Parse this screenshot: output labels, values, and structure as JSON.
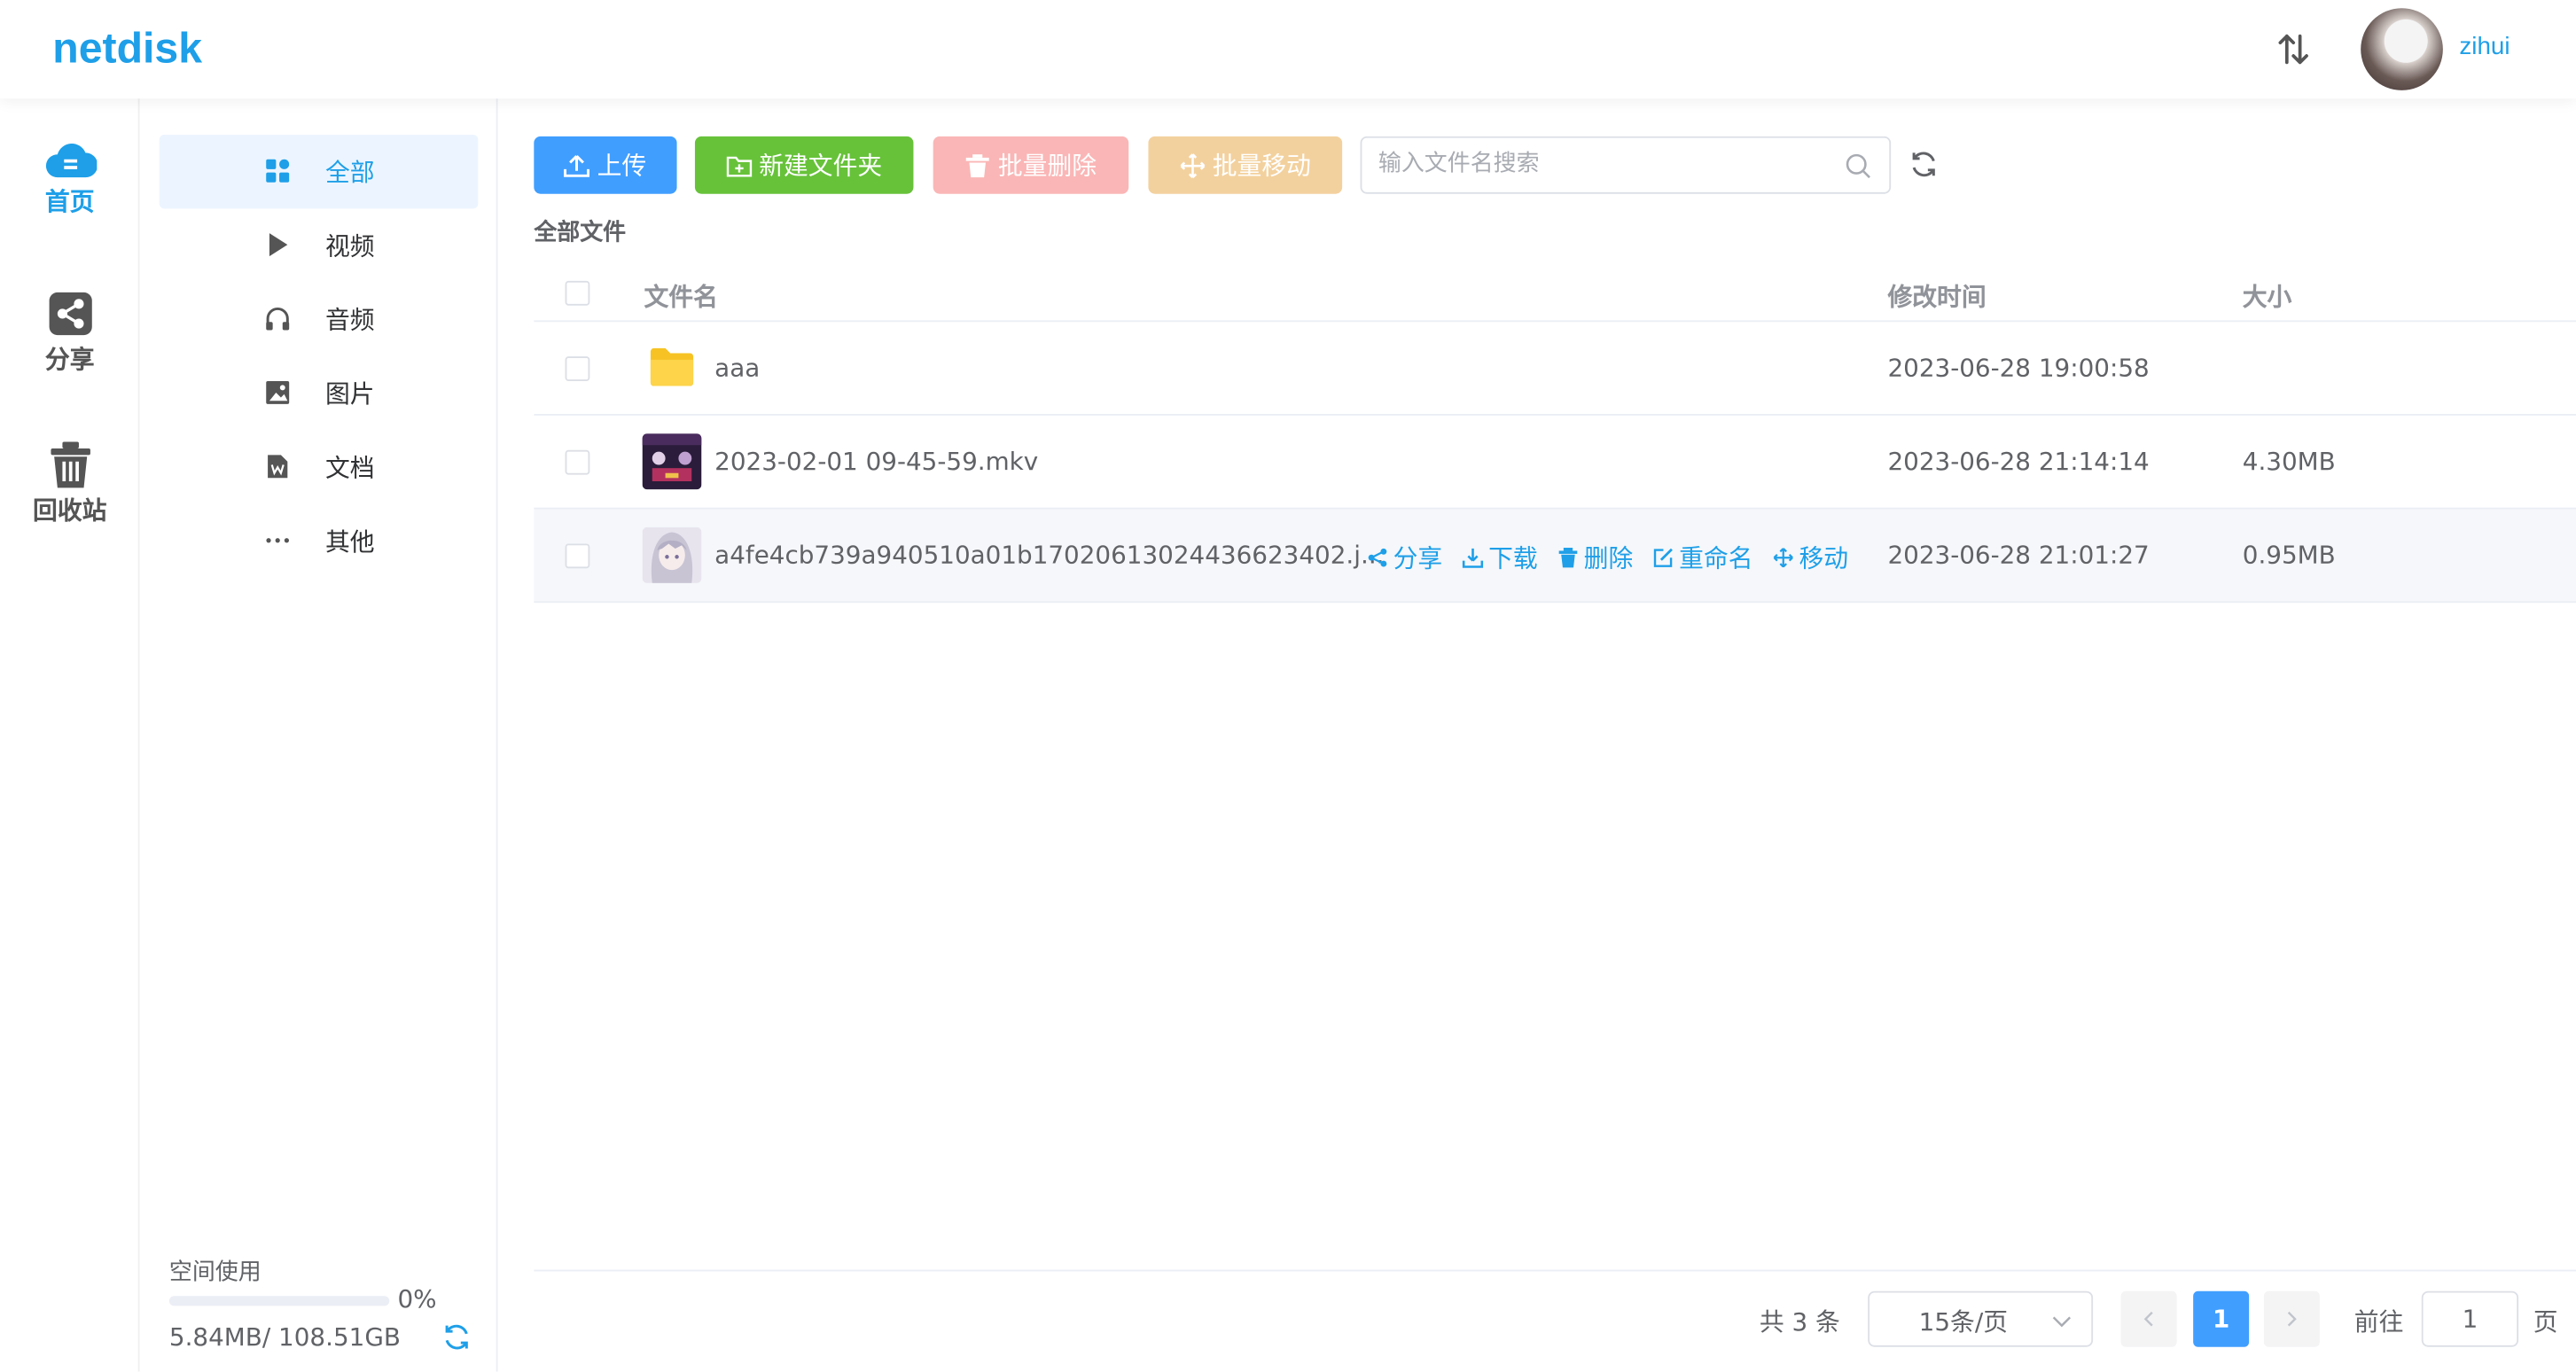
{
  "header": {
    "logo": "netdisk",
    "username": "zihui"
  },
  "leftnav": [
    {
      "label": "首页",
      "icon": "cloud-icon",
      "active": true
    },
    {
      "label": "分享",
      "icon": "share-icon",
      "active": false
    },
    {
      "label": "回收站",
      "icon": "trash-icon",
      "active": false
    }
  ],
  "categories": [
    {
      "label": "全部",
      "icon": "grid-icon",
      "active": true
    },
    {
      "label": "视频",
      "icon": "play-icon"
    },
    {
      "label": "音频",
      "icon": "headphones-icon"
    },
    {
      "label": "图片",
      "icon": "image-icon"
    },
    {
      "label": "文档",
      "icon": "document-icon"
    },
    {
      "label": "其他",
      "icon": "more-icon"
    }
  ],
  "space": {
    "label": "空间使用",
    "percent": "0%",
    "usage": "5.84MB/ 108.51GB",
    "fraction": 0.0
  },
  "toolbar": {
    "upload": "上传",
    "new_folder": "新建文件夹",
    "batch_delete": "批量删除",
    "batch_move": "批量移动",
    "search_placeholder": "输入文件名搜索"
  },
  "breadcrumb": "全部文件",
  "table": {
    "columns": {
      "name": "文件名",
      "time": "修改时间",
      "size": "大小"
    },
    "rows": [
      {
        "name": "aaa",
        "time": "2023-06-28 19:00:58",
        "size": "",
        "type": "folder"
      },
      {
        "name": "2023-02-01 09-45-59.mkv",
        "time": "2023-06-28 21:14:14",
        "size": "4.30MB",
        "type": "video"
      },
      {
        "name": "a4fe4cb739a940510a01b17020613024436623402.j...",
        "time": "2023-06-28 21:01:27",
        "size": "0.95MB",
        "type": "image"
      }
    ],
    "row_actions": {
      "share": "分享",
      "download": "下载",
      "delete": "删除",
      "rename": "重命名",
      "move": "移动"
    }
  },
  "pagination": {
    "total": "共 3 条",
    "page_size": "15条/页",
    "current_page": "1",
    "goto_label": "前往",
    "goto_value": "1",
    "page_suffix": "页"
  },
  "colors": {
    "primary": "#409eff",
    "brand": "#1e9fe8",
    "success": "#67c23a",
    "danger_disabled": "#fab6b6",
    "warning_disabled": "#f3d19e"
  }
}
